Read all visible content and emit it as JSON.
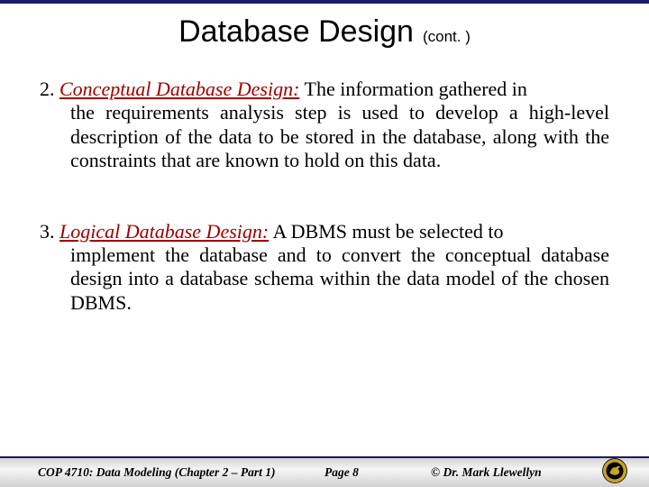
{
  "title": {
    "main": "Database Design",
    "sub": "(cont. )"
  },
  "items": [
    {
      "num": "2. ",
      "term": "Conceptual Database Design:",
      "first_line_rest": "  The information gathered in",
      "rest": "the requirements analysis step is used to develop a high-level description of the data to be stored in the database, along with the constraints that are known to hold on this data."
    },
    {
      "num": "3. ",
      "term": "Logical Database Design:",
      "first_line_rest": "  A DBMS must be selected to",
      "rest": "implement the database and to convert the conceptual database design into a database schema within the data model of the chosen DBMS."
    }
  ],
  "footer": {
    "left": "COP 4710: Data Modeling (Chapter 2 – Part 1)",
    "center": "Page 8",
    "right": "© Dr. Mark Llewellyn"
  },
  "logo_name": "ucf-pegasus-logo"
}
